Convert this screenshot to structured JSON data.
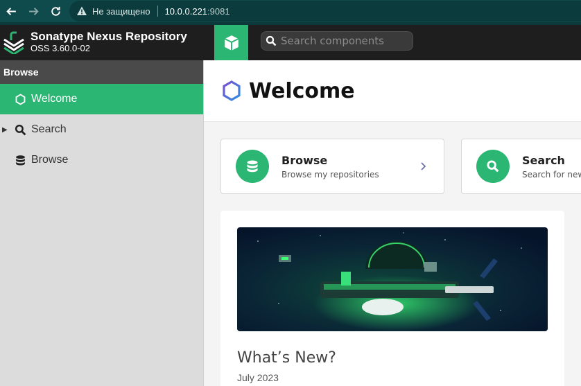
{
  "browser": {
    "security_warning": "Не защищено",
    "url_host": "10.0.0.221",
    "url_port": ":9081"
  },
  "header": {
    "app_title": "Sonatype Nexus Repository",
    "version": "OSS 3.60.0-02",
    "search_placeholder": "Search components"
  },
  "sidebar": {
    "section_title": "Browse",
    "items": [
      {
        "label": "Welcome",
        "icon": "hexagon-icon",
        "active": true
      },
      {
        "label": "Search",
        "icon": "search-icon",
        "expandable": true
      },
      {
        "label": "Browse",
        "icon": "database-icon"
      }
    ]
  },
  "main": {
    "title": "Welcome",
    "cards": [
      {
        "title": "Browse",
        "subtitle": "Browse my repositories",
        "icon": "database-icon"
      },
      {
        "title": "Search",
        "subtitle": "Search for new",
        "icon": "search-icon"
      }
    ],
    "news": {
      "title": "What’s New?",
      "date": "July 2023"
    }
  },
  "colors": {
    "accent": "#2bb673",
    "browser_bar": "#0f4a4c",
    "header_bg": "#1e1e1e",
    "sidebar_bg": "#dcdcdc"
  }
}
